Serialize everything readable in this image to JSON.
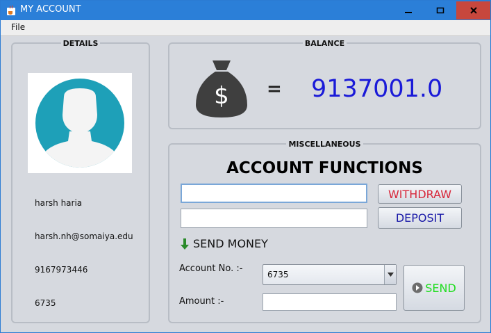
{
  "window": {
    "title": "MY ACCOUNT",
    "controls": {
      "minimize": "—",
      "maximize": "□",
      "close": "✕"
    }
  },
  "menu": {
    "file": "File"
  },
  "details": {
    "title": "DETAILS",
    "name": "harsh haria",
    "email": "harsh.nh@somaiya.edu",
    "phone": "9167973446",
    "account_no": "6735"
  },
  "balance": {
    "title": "BALANCE",
    "equals": "=",
    "value": "9137001.0"
  },
  "misc": {
    "title": "MISCELLANEOUS",
    "functions_title": "ACCOUNT FUNCTIONS",
    "withdraw_input": "",
    "deposit_input": "",
    "withdraw_label": "WITHDRAW",
    "deposit_label": "DEPOSIT",
    "send_money_label": "SEND MONEY",
    "account_label": "Account No. :-",
    "account_selected": "6735",
    "amount_label": "Amount :-",
    "amount_value": "",
    "send_label": "SEND"
  },
  "colors": {
    "titlebar": "#2b7fd8",
    "close": "#c7473d",
    "balance_value": "#1a1ad8",
    "withdraw": "#d7273a",
    "deposit": "#1a1aa8",
    "send": "#22dd22",
    "avatar": "#1ea0b8"
  },
  "icons": [
    "java-app-icon",
    "avatar-icon",
    "money-bag-icon",
    "arrow-down-icon",
    "send-arrow-icon",
    "chevron-down-icon"
  ]
}
